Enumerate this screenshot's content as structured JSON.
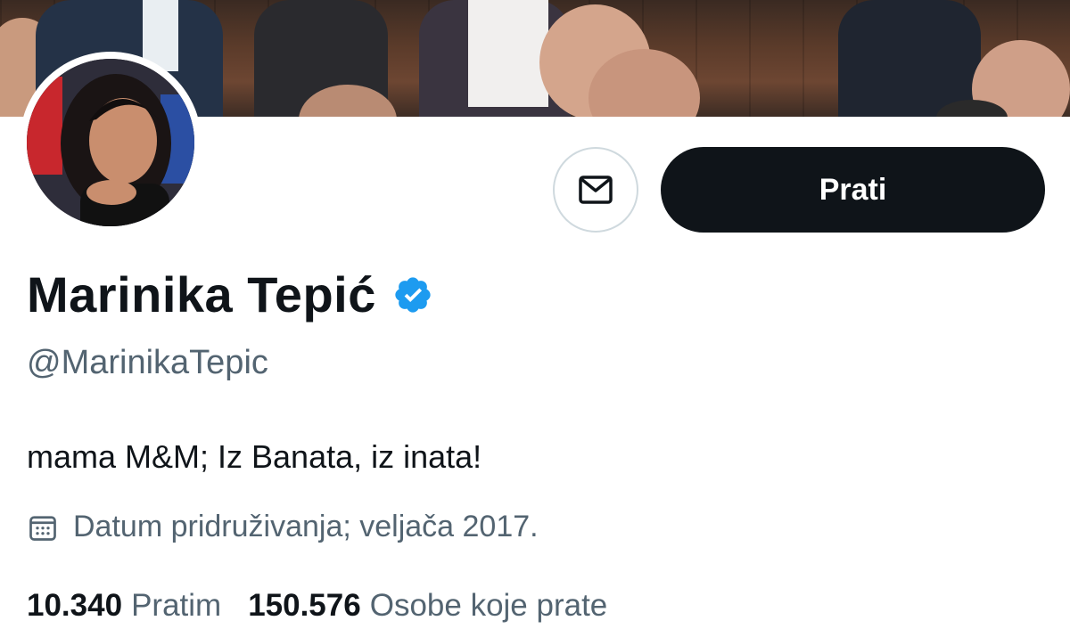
{
  "profile": {
    "display_name": "Marinika Tepić",
    "handle": "@MarinikaTepic",
    "bio": "mama M&M; Iz Banata, iz inata!",
    "joined": "Datum pridruživanja; veljača 2017.",
    "verified_icon": "verified-badge-icon",
    "accent_color": "#1d9bf0"
  },
  "actions": {
    "follow_label": "Prati",
    "message_icon": "envelope-icon"
  },
  "stats": {
    "following_count": "10.340",
    "following_label": "Pratim",
    "followers_count": "150.576",
    "followers_label": "Osobe koje prate"
  }
}
